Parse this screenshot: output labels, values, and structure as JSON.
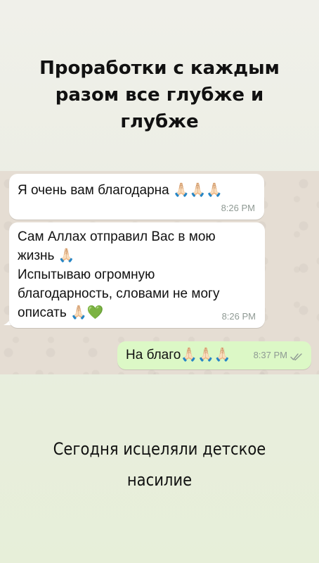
{
  "story": {
    "title_lines": [
      "Проработки с каждым",
      "разом все глубже и",
      "глубже"
    ],
    "caption_lines": [
      "Сегодня исцеляли детское",
      "насилие"
    ]
  },
  "chat": {
    "messages": [
      {
        "direction": "incoming",
        "lines": [
          "Я очень вам благодарна 🙏🏻🙏🏻🙏🏻"
        ],
        "time": "8:26 PM"
      },
      {
        "direction": "incoming",
        "lines": [
          "Сам Аллах отправил Вас в мою",
          "жизнь 🙏🏻",
          "Испытываю огромную",
          "благодарность, словами не могу",
          "описать 🙏🏻💚"
        ],
        "time": "8:26 PM"
      },
      {
        "direction": "outgoing",
        "lines": [
          "На благо🙏🏻🙏🏻🙏🏻"
        ],
        "time": "8:37 PM",
        "status_icon": "double-check-icon"
      }
    ]
  },
  "colors": {
    "incoming_bubble": "#ffffff",
    "outgoing_bubble": "#dcf8c6",
    "chat_background": "#e5ddd3",
    "timestamp": "#8f9a94"
  }
}
